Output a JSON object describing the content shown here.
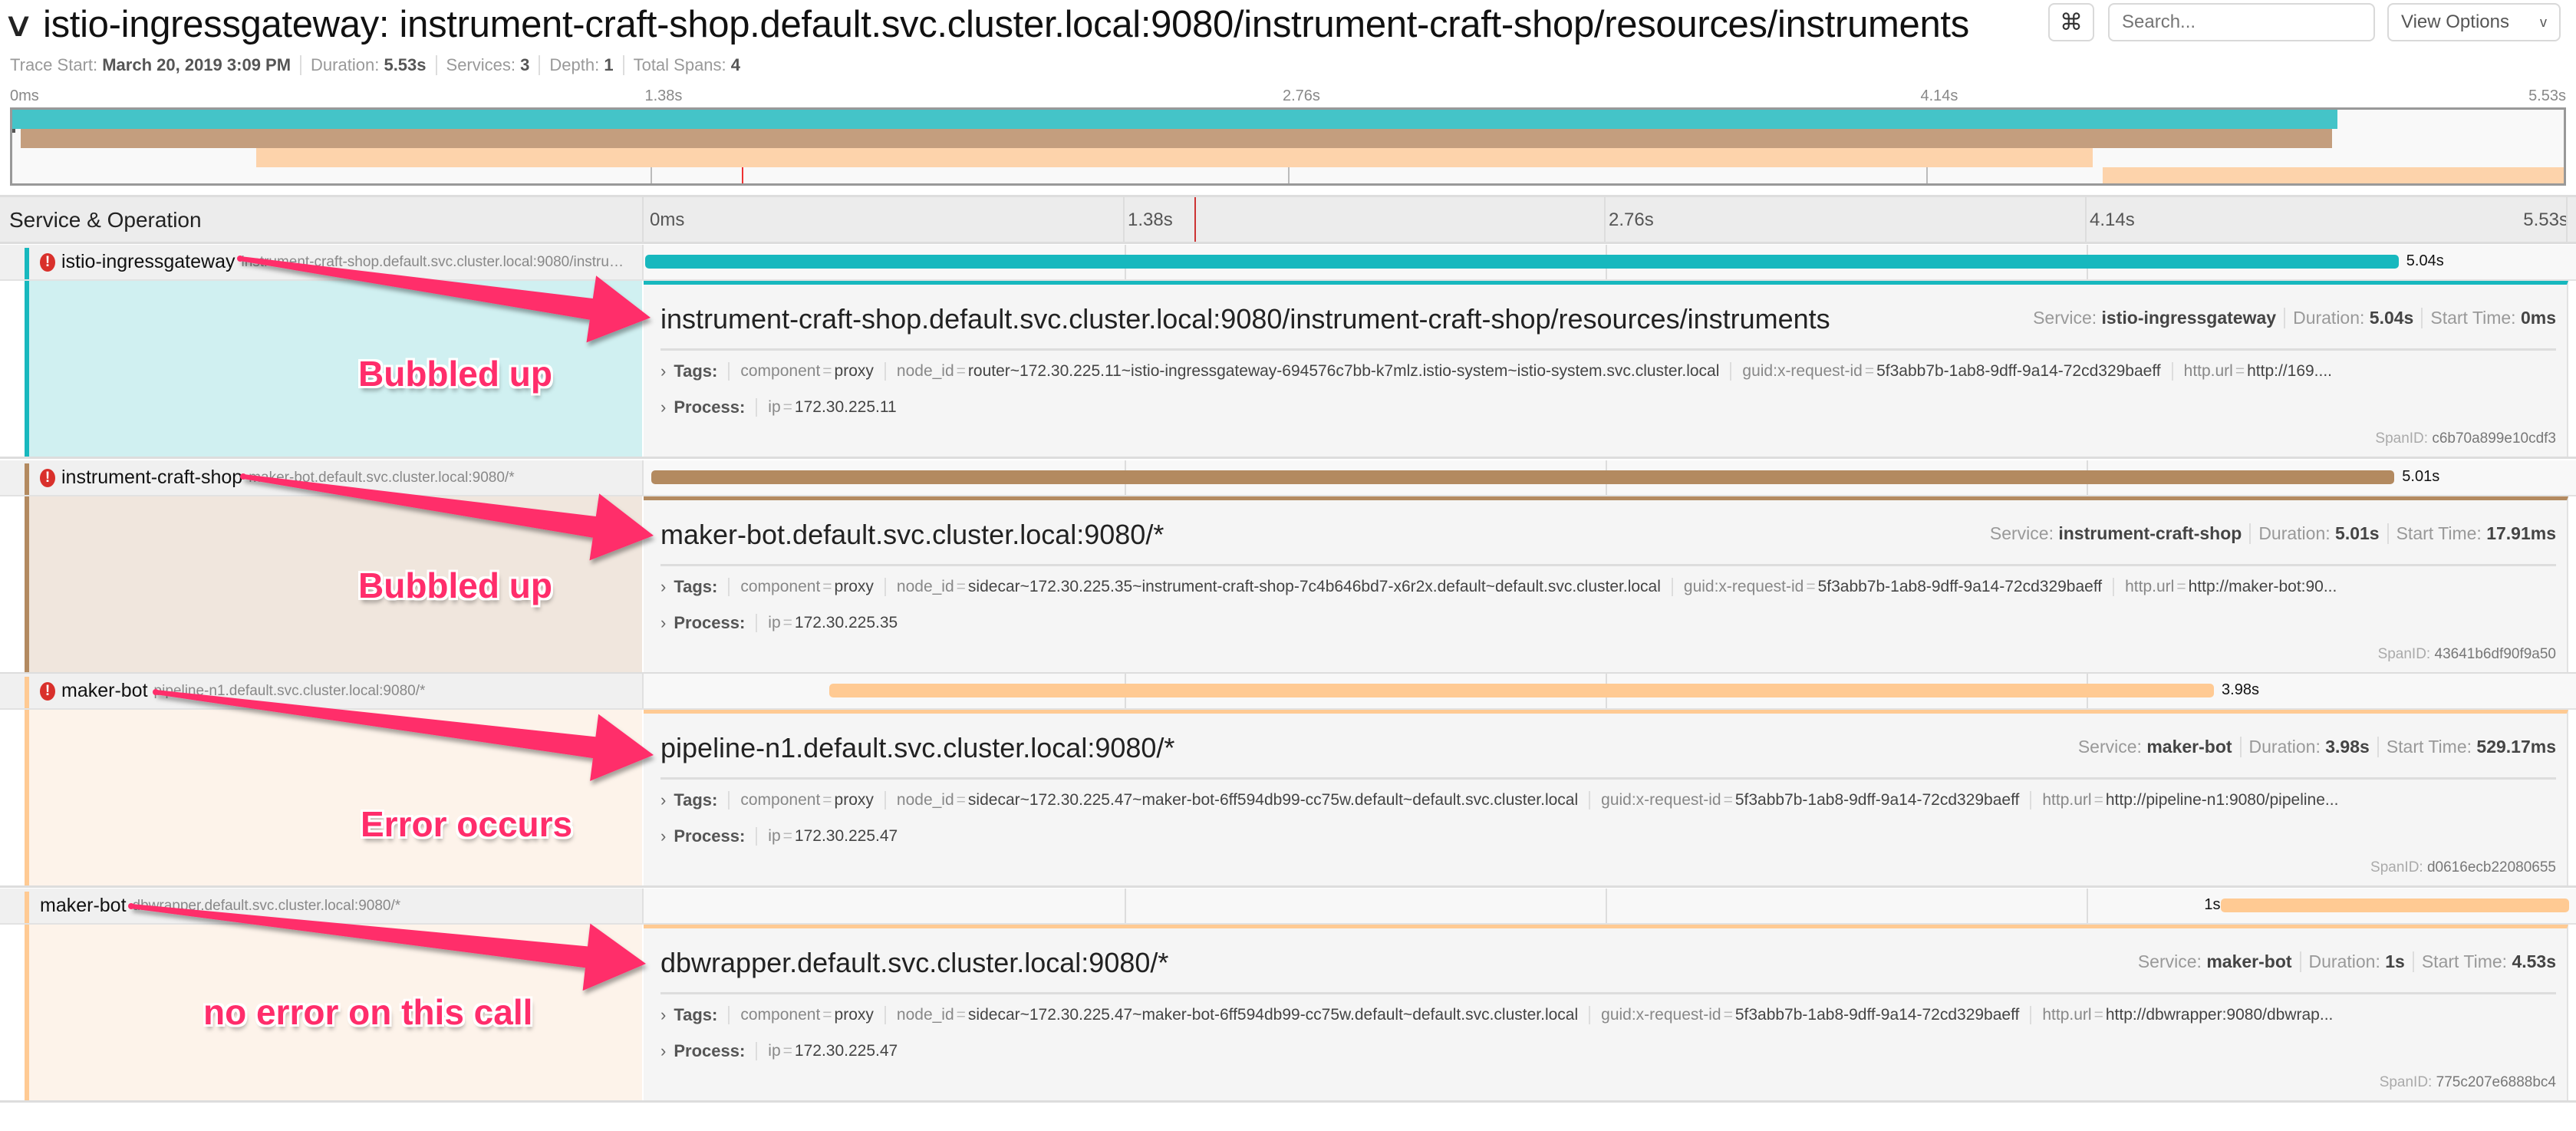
{
  "header": {
    "title": "istio-ingressgateway: instrument-craft-shop.default.svc.cluster.local:9080/instrument-craft-shop/resources/instruments",
    "collapse_icon": "chevron-down-icon",
    "shortcut_label": "⌘",
    "search_placeholder": "Search...",
    "view_options_label": "View Options",
    "view_options_chevron": "v"
  },
  "meta": {
    "trace_start_label": "Trace Start:",
    "trace_start": "March 20, 2019 3:09 PM",
    "duration_label": "Duration:",
    "duration": "5.53s",
    "services_label": "Services:",
    "services": "3",
    "depth_label": "Depth:",
    "depth": "1",
    "total_spans_label": "Total Spans:",
    "total_spans": "4"
  },
  "timeline": {
    "total_s": 5.53,
    "ticks": [
      "0ms",
      "1.38s",
      "2.76s",
      "4.14s",
      "5.53s"
    ],
    "column_header": "Service & Operation"
  },
  "colors": {
    "istio-ingressgateway": {
      "bar": "#17b8be",
      "mini": "#44c4c8",
      "fill": "#d0f0f1"
    },
    "instrument-craft-shop": {
      "bar": "#b38a60",
      "mini": "#c49e7e",
      "fill": "#f0e6dd"
    },
    "maker-bot": {
      "bar": "#ffca93",
      "mini": "#fdd3ab",
      "fill": "#fdf3ea"
    },
    "annotation": "#ff2d6b",
    "error": "#d9302b"
  },
  "spans": [
    {
      "service": "istio-ingressgateway",
      "error": true,
      "operation": "instrument-craft-shop.default.svc.cluster.local:9080/instrument-craft-shop/resources/instruments",
      "start_s": 0,
      "duration_s": 5.04,
      "bar_label": "5.04s",
      "detail": {
        "title": "instrument-craft-shop.default.svc.cluster.local:9080/instrument-craft-shop/resources/instruments",
        "service_label": "Service:",
        "service": "istio-ingressgateway",
        "duration_label": "Duration:",
        "duration": "5.04s",
        "start_label": "Start Time:",
        "start": "0ms",
        "tags_label": "Tags:",
        "tags": [
          {
            "k": "component",
            "v": "proxy"
          },
          {
            "k": "node_id",
            "v": "router~172.30.225.11~istio-ingressgateway-694576c7bb-k7mlz.istio-system~istio-system.svc.cluster.local"
          },
          {
            "k": "guid:x-request-id",
            "v": "5f3abb7b-1ab8-9dff-9a14-72cd329baeff"
          },
          {
            "k": "http.url",
            "v": "http://169...."
          }
        ],
        "process_label": "Process:",
        "process": [
          {
            "k": "ip",
            "v": "172.30.225.11"
          }
        ],
        "span_id_label": "SpanID:",
        "span_id": "c6b70a899e10cdf3"
      },
      "annotation": "Bubbled up"
    },
    {
      "service": "instrument-craft-shop",
      "error": true,
      "operation": "maker-bot.default.svc.cluster.local:9080/*",
      "start_s": 0.01791,
      "duration_s": 5.01,
      "bar_label": "5.01s",
      "detail": {
        "title": "maker-bot.default.svc.cluster.local:9080/*",
        "service_label": "Service:",
        "service": "instrument-craft-shop",
        "duration_label": "Duration:",
        "duration": "5.01s",
        "start_label": "Start Time:",
        "start": "17.91ms",
        "tags_label": "Tags:",
        "tags": [
          {
            "k": "component",
            "v": "proxy"
          },
          {
            "k": "node_id",
            "v": "sidecar~172.30.225.35~instrument-craft-shop-7c4b646bd7-x6r2x.default~default.svc.cluster.local"
          },
          {
            "k": "guid:x-request-id",
            "v": "5f3abb7b-1ab8-9dff-9a14-72cd329baeff"
          },
          {
            "k": "http.url",
            "v": "http://maker-bot:90..."
          }
        ],
        "process_label": "Process:",
        "process": [
          {
            "k": "ip",
            "v": "172.30.225.35"
          }
        ],
        "span_id_label": "SpanID:",
        "span_id": "43641b6df90f9a50"
      },
      "annotation": "Bubbled up"
    },
    {
      "service": "maker-bot",
      "error": true,
      "operation": "pipeline-n1.default.svc.cluster.local:9080/*",
      "start_s": 0.52917,
      "duration_s": 3.98,
      "bar_label": "3.98s",
      "detail": {
        "title": "pipeline-n1.default.svc.cluster.local:9080/*",
        "service_label": "Service:",
        "service": "maker-bot",
        "duration_label": "Duration:",
        "duration": "3.98s",
        "start_label": "Start Time:",
        "start": "529.17ms",
        "tags_label": "Tags:",
        "tags": [
          {
            "k": "component",
            "v": "proxy"
          },
          {
            "k": "node_id",
            "v": "sidecar~172.30.225.47~maker-bot-6ff594db99-cc75w.default~default.svc.cluster.local"
          },
          {
            "k": "guid:x-request-id",
            "v": "5f3abb7b-1ab8-9dff-9a14-72cd329baeff"
          },
          {
            "k": "http.url",
            "v": "http://pipeline-n1:9080/pipeline..."
          }
        ],
        "process_label": "Process:",
        "process": [
          {
            "k": "ip",
            "v": "172.30.225.47"
          }
        ],
        "span_id_label": "SpanID:",
        "span_id": "d0616ecb22080655"
      },
      "annotation": "Error occurs"
    },
    {
      "service": "maker-bot",
      "error": false,
      "operation": "dbwrapper.default.svc.cluster.local:9080/*",
      "start_s": 4.53,
      "duration_s": 1.0,
      "bar_label": "1s",
      "detail": {
        "title": "dbwrapper.default.svc.cluster.local:9080/*",
        "service_label": "Service:",
        "service": "maker-bot",
        "duration_label": "Duration:",
        "duration": "1s",
        "start_label": "Start Time:",
        "start": "4.53s",
        "tags_label": "Tags:",
        "tags": [
          {
            "k": "component",
            "v": "proxy"
          },
          {
            "k": "node_id",
            "v": "sidecar~172.30.225.47~maker-bot-6ff594db99-cc75w.default~default.svc.cluster.local"
          },
          {
            "k": "guid:x-request-id",
            "v": "5f3abb7b-1ab8-9dff-9a14-72cd329baeff"
          },
          {
            "k": "http.url",
            "v": "http://dbwrapper:9080/dbwrap..."
          }
        ],
        "process_label": "Process:",
        "process": [
          {
            "k": "ip",
            "v": "172.30.225.47"
          }
        ],
        "span_id_label": "SpanID:",
        "span_id": "775c207e6888bc4"
      },
      "annotation": "no error on this call"
    }
  ]
}
